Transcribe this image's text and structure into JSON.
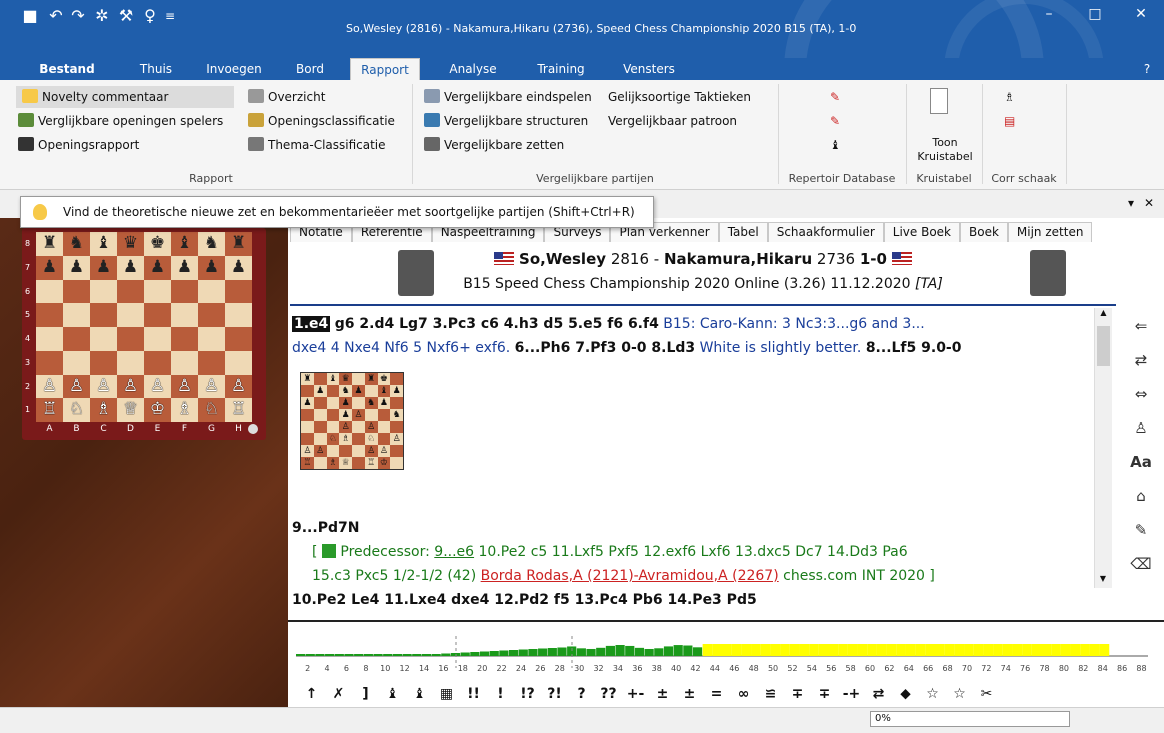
{
  "window": {
    "title": "So,Wesley (2816) - Nakamura,Hikaru (2736), Speed Chess Championship 2020  B15  (TA), 1-0"
  },
  "menu_tabs": [
    "Bestand",
    "Thuis",
    "Invoegen",
    "Bord",
    "Rapport",
    "Analyse",
    "Training",
    "Vensters"
  ],
  "ribbon": {
    "rapport_items": [
      "Novelty commentaar",
      "Verglijkbare openingen spelers",
      "Openingsrapport"
    ],
    "overzicht_items": [
      "Overzicht",
      "Openingsclassificatie",
      "Thema-Classificatie"
    ],
    "vergelijk_items": [
      "Vergelijkbare eindspelen",
      "Vergelijkbare structuren",
      "Vergelijkbare zetten"
    ],
    "vergelijk_items2": [
      "Gelijksoortige Taktieken",
      "Vergelijkbaar patroon"
    ],
    "kruistabel_button": "Toon Kruistabel",
    "groups": [
      "Rapport",
      "Vergelijkbare partijen",
      "Repertoir Database",
      "Kruistabel",
      "Corr schaak"
    ]
  },
  "tooltip": "Vind de theoretische nieuwe zet en bekommentarieëer met soortgelijke partijen (Shift+Ctrl+R)",
  "notation_tabs": [
    "Notatie",
    "Referentie",
    "Naspeeltraining",
    "Surveys",
    "Plan verkenner",
    "Tabel",
    "Schaakformulier",
    "Live Boek",
    "Boek",
    "Mijn zetten"
  ],
  "game_header": {
    "white": "So,Wesley",
    "white_elo": "2816",
    "black": "Nakamura,Hikaru",
    "black_elo": "2736",
    "result": "1-0",
    "line2": "B15 Speed Chess Championship 2020 Online (3.26) 11.12.2020",
    "annotator": "[TA]"
  },
  "notation": {
    "first": "1.e4",
    "line1": "g6 2.d4 Lg7 3.Pc3 c6 4.h3 d5 5.e5 f6 6.f4",
    "comment1": "B15: Caro-Kann: 3 Nc3:3...g6 and 3...",
    "comment1b": "dxe4 4 Nxe4 Nf6 5 Nxf6+ exf6.",
    "line2": "6...Ph6 7.Pf3 0-0 8.Ld3",
    "comment2": "White is slightly better.",
    "line2b": "8...Lf5 9.0-0",
    "novelty": "9...Pd7N",
    "bracket_open": "[",
    "predecessor_label": "Predecessor:",
    "pred_move": "9...e6",
    "pred_line1": "10.Pe2 c5 11.Lxf5 Pxf5 12.exf6 Lxf6 13.dxc5 Dc7 14.Dd3 Pa6",
    "pred_line2": "15.c3 Pxc5 1/2-1/2 (42)",
    "pred_players": "Borda Rodas,A (2121)-Avramidou,A (2267)",
    "pred_event": "chess.com INT 2020 ]",
    "line3": "10.Pe2 Le4 11.Lxe4 dxe4 12.Pd2 f5 13.Pc4 Pb6 14.Pe3 Pd5"
  },
  "board": {
    "files": [
      "A",
      "B",
      "C",
      "D",
      "E",
      "F",
      "G",
      "H"
    ],
    "ranks": [
      "8",
      "7",
      "6",
      "5",
      "4",
      "3",
      "2",
      "1"
    ]
  },
  "eval": {
    "ticks": [
      "2",
      "4",
      "6",
      "8",
      "10",
      "12",
      "14",
      "16",
      "18",
      "20",
      "22",
      "24",
      "26",
      "28",
      "30",
      "32",
      "34",
      "36",
      "38",
      "40",
      "42",
      "44",
      "46",
      "48",
      "50",
      "52",
      "54",
      "56",
      "58",
      "60",
      "62",
      "64",
      "66",
      "68",
      "70",
      "72",
      "74",
      "76",
      "78",
      "80",
      "82",
      "84",
      "86",
      "88"
    ],
    "symbols": [
      "↑",
      "✗",
      "]",
      "♝",
      "♝",
      "▦",
      "!!",
      "!",
      "!?",
      "?!",
      "?",
      "??",
      "+-",
      "±",
      "±",
      "=",
      "∞",
      "≌",
      "∓",
      "∓",
      "-+",
      "⇄",
      "⬥",
      "☆",
      "☆",
      "✂"
    ]
  },
  "status": {
    "progress": "0%"
  },
  "colors": {
    "accent": "#1f5eab",
    "highlight_bar": "#ffff00",
    "eval_green": "#1a9a1a"
  }
}
